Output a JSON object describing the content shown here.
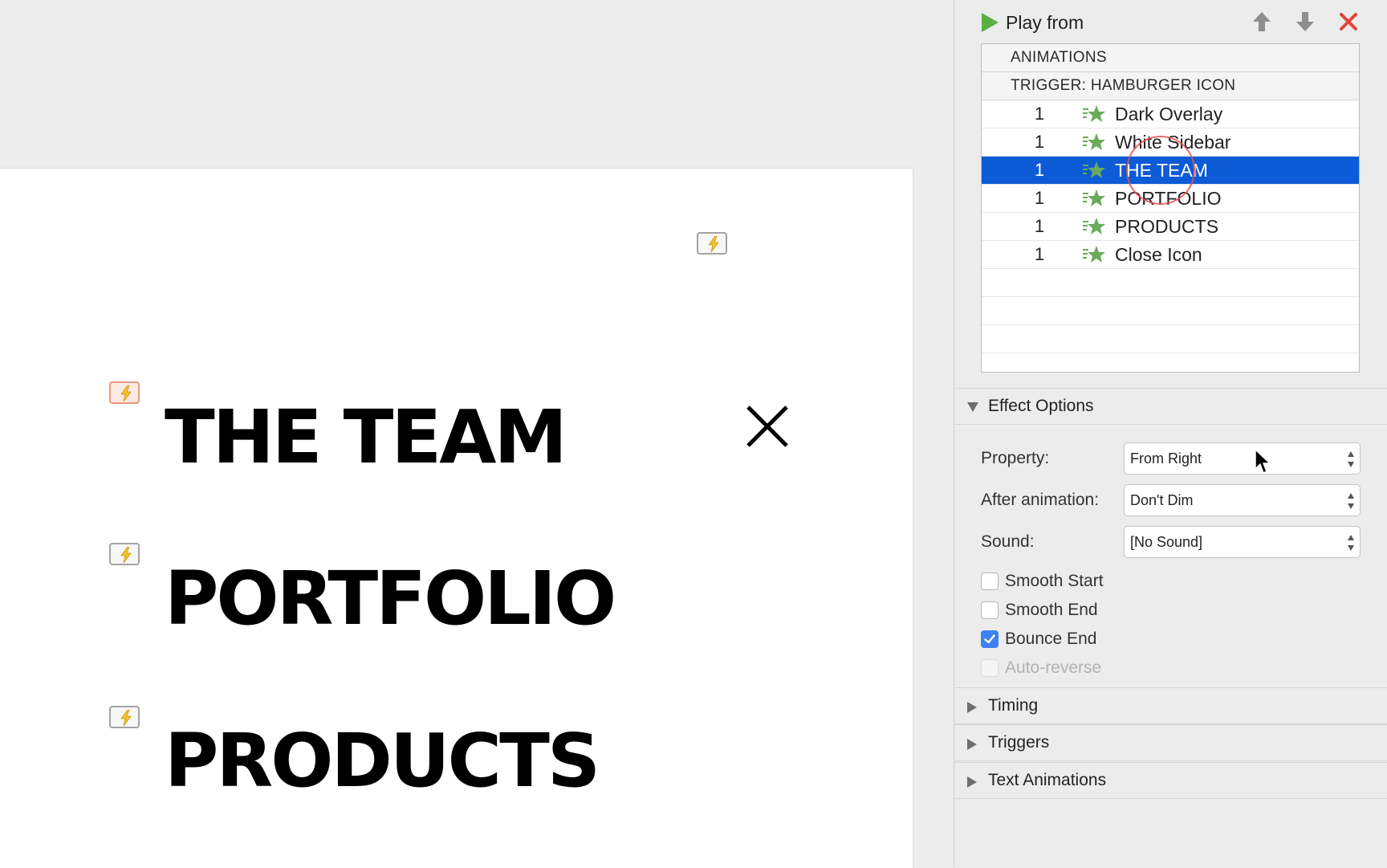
{
  "slide": {
    "items": [
      {
        "text": "THE TEAM"
      },
      {
        "text": "PORTFOLIO"
      },
      {
        "text": "PRODUCTS"
      }
    ]
  },
  "panel": {
    "play_from_label": "Play from",
    "list": {
      "header": "ANIMATIONS",
      "trigger_header": "TRIGGER: HAMBURGER ICON",
      "rows": [
        {
          "order": "1",
          "name": "Dark Overlay"
        },
        {
          "order": "1",
          "name": "White Sidebar"
        },
        {
          "order": "1",
          "name": "THE TEAM",
          "selected": true
        },
        {
          "order": "1",
          "name": "PORTFOLIO"
        },
        {
          "order": "1",
          "name": "PRODUCTS"
        },
        {
          "order": "1",
          "name": "Close Icon"
        }
      ]
    },
    "effect_options": {
      "title": "Effect Options",
      "property_label": "Property:",
      "property_value": "From Right",
      "after_animation_label": "After animation:",
      "after_animation_value": "Don't Dim",
      "sound_label": "Sound:",
      "sound_value": "[No Sound]",
      "checkboxes": [
        {
          "label": "Smooth Start",
          "checked": false,
          "enabled": true
        },
        {
          "label": "Smooth End",
          "checked": false,
          "enabled": true
        },
        {
          "label": "Bounce End",
          "checked": true,
          "enabled": true
        },
        {
          "label": "Auto-reverse",
          "checked": false,
          "enabled": false
        }
      ]
    },
    "sections": {
      "timing": "Timing",
      "triggers": "Triggers",
      "text_animations": "Text Animations"
    }
  },
  "colors": {
    "selection": "#0d5bd6",
    "play_icon": "#5bb044",
    "star_icon": "#6aab5a",
    "delete_icon": "#e0443a",
    "checkbox_checked": "#3d82f0"
  },
  "icons": {
    "play": "play-icon",
    "move_up": "arrow-up-icon",
    "move_down": "arrow-down-icon",
    "delete": "delete-x-icon",
    "effect": "star-effect-icon",
    "trigger": "lightning-trigger-icon"
  }
}
